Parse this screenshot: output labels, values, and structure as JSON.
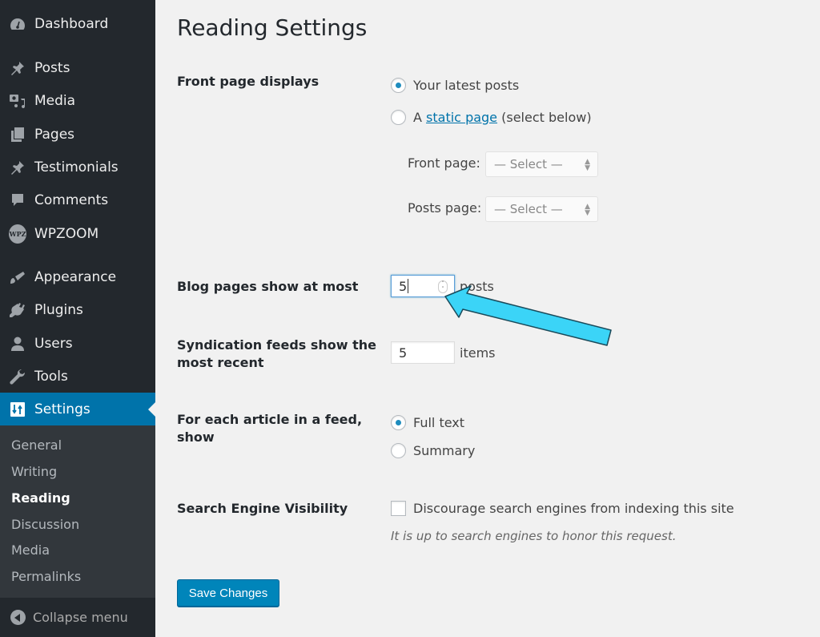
{
  "sidebar": {
    "items": [
      {
        "label": "Dashboard",
        "icon": "dashboard-icon"
      },
      {
        "label": "Posts",
        "icon": "pin-icon"
      },
      {
        "label": "Media",
        "icon": "media-icon"
      },
      {
        "label": "Pages",
        "icon": "pages-icon"
      },
      {
        "label": "Testimonials",
        "icon": "pin-icon"
      },
      {
        "label": "Comments",
        "icon": "comment-icon"
      },
      {
        "label": "WPZOOM",
        "icon": "wpzoom-logo-icon",
        "badge_text": "WPZ"
      },
      {
        "label": "Appearance",
        "icon": "paintbrush-icon"
      },
      {
        "label": "Plugins",
        "icon": "plug-icon"
      },
      {
        "label": "Users",
        "icon": "user-icon"
      },
      {
        "label": "Tools",
        "icon": "wrench-icon"
      },
      {
        "label": "Settings",
        "icon": "settings-sliders-icon",
        "active": true
      }
    ],
    "submenu": [
      {
        "label": "General"
      },
      {
        "label": "Writing"
      },
      {
        "label": "Reading",
        "current": true
      },
      {
        "label": "Discussion"
      },
      {
        "label": "Media"
      },
      {
        "label": "Permalinks"
      }
    ],
    "collapse_label": "Collapse menu"
  },
  "main": {
    "title": "Reading Settings",
    "front_page": {
      "label": "Front page displays",
      "option_latest": "Your latest posts",
      "option_static_prefix": "A",
      "option_static_link": "static page",
      "option_static_suffix": "(select below)",
      "selected": "latest",
      "front_page_label": "Front page:",
      "front_page_value": "— Select —",
      "posts_page_label": "Posts page:",
      "posts_page_value": "— Select —"
    },
    "blog_pages": {
      "label": "Blog pages show at most",
      "value": "5",
      "unit": "posts"
    },
    "syndication": {
      "label_line1": "Syndication feeds show the",
      "label_line2": "most recent",
      "value": "5",
      "unit": "items"
    },
    "feed_article": {
      "label_line1": "For each article in a feed,",
      "label_line2": "show",
      "option_full": "Full text",
      "option_summary": "Summary",
      "selected": "full"
    },
    "search_visibility": {
      "label": "Search Engine Visibility",
      "checkbox_label": "Discourage search engines from indexing this site",
      "checked": false,
      "description": "It is up to search engines to honor this request."
    },
    "save_label": "Save Changes"
  },
  "annotation": {
    "arrow_color": "#3bd4f7",
    "arrow_target": "blog-pages-input"
  }
}
